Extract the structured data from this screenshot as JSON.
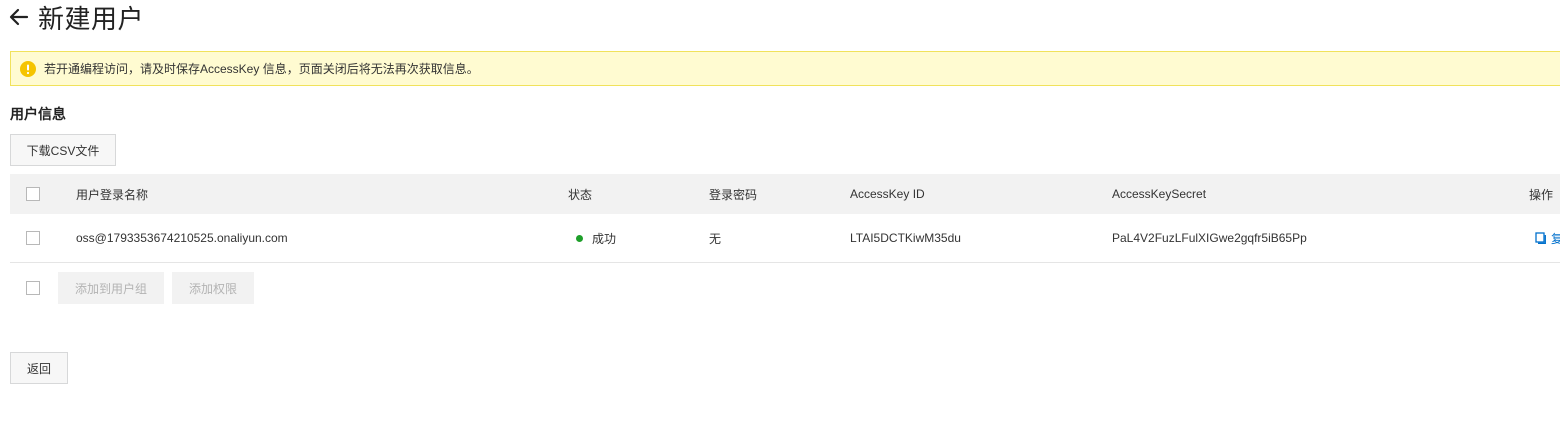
{
  "header": {
    "title": "新建用户",
    "back_icon": "arrow-left-icon"
  },
  "alert": {
    "icon": "warning-icon",
    "text": "若开通编程访问，请及时保存AccessKey 信息，页面关闭后将无法再次获取信息。",
    "background": "#fffbd1",
    "border": "#f1e25b",
    "icon_color": "#f5c400"
  },
  "section": {
    "title": "用户信息"
  },
  "toolbar": {
    "download_label": "下载CSV文件"
  },
  "table": {
    "columns": [
      "用户登录名称",
      "状态",
      "登录密码",
      "AccessKey ID",
      "AccessKeySecret",
      "操作"
    ],
    "rows": [
      {
        "login_name": "oss@1793353674210525.onaliyun.com",
        "status": "成功",
        "password": "无",
        "access_key_id": "LTAI5DCTKiwM35du",
        "access_key_secret": "PaL4V2FuzLFulXIGwe2gqfr5iB65Pp",
        "action": "复"
      }
    ],
    "status_color": "#1e9f2a",
    "link_color": "#0070cc"
  },
  "bulk_actions": {
    "add_to_group": "添加到用户组",
    "add_permission": "添加权限"
  },
  "footer": {
    "back_label": "返回"
  }
}
